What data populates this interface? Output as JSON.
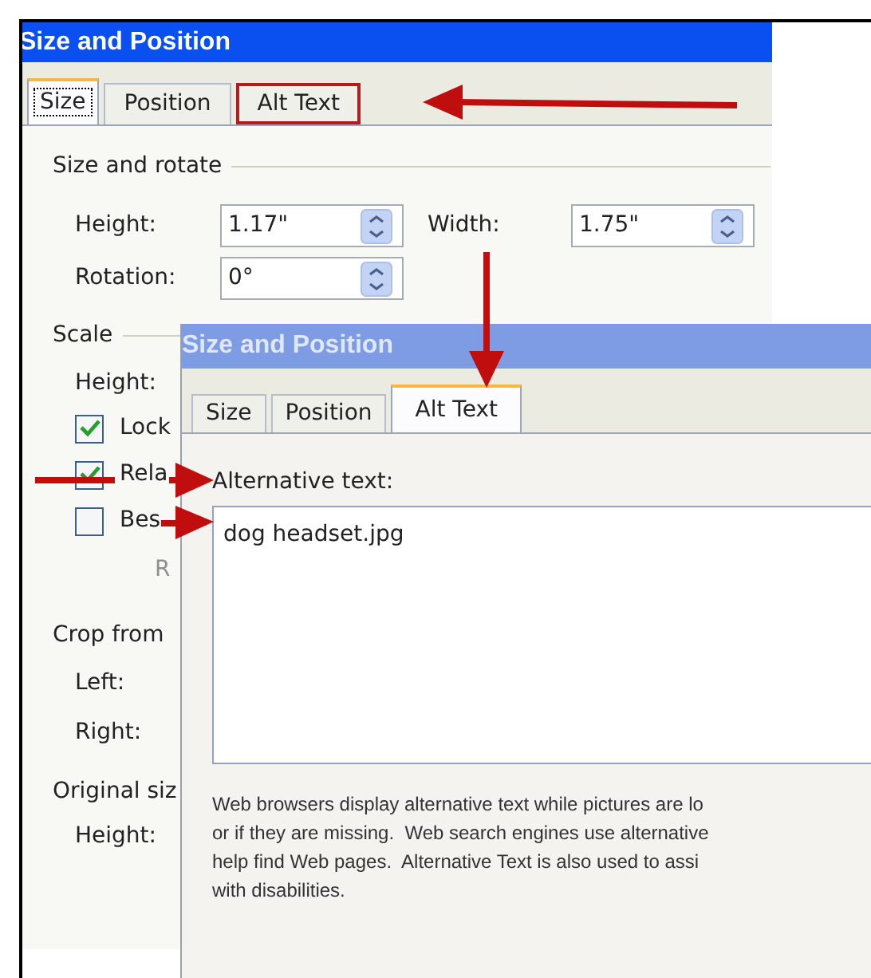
{
  "back_dialog": {
    "title": "Size and Position",
    "tabs": [
      {
        "label": "Size",
        "selected": true,
        "highlighted": false
      },
      {
        "label": "Position",
        "selected": false,
        "highlighted": false
      },
      {
        "label": "Alt Text",
        "selected": false,
        "highlighted": true
      }
    ],
    "size_and_rotate": {
      "heading": "Size and rotate",
      "fields": [
        {
          "label": "Height:",
          "value": "1.17\""
        },
        {
          "label": "Width:",
          "value": "1.75\""
        },
        {
          "label": "Rotation:",
          "value": "0°"
        }
      ]
    },
    "scale": {
      "heading": "Scale",
      "height_label": "Height:",
      "checkboxes": [
        {
          "label": "Lock",
          "checked": true
        },
        {
          "label": "Rela",
          "checked": true
        },
        {
          "label": "Bes",
          "checked": false
        }
      ],
      "button_fragment": "R"
    },
    "crop_from": {
      "heading": "Crop from",
      "labels": [
        "Left:",
        "Right:"
      ]
    },
    "original_size": {
      "heading": "Original siz",
      "labels": [
        "Height:"
      ]
    }
  },
  "front_dialog": {
    "title": "Size and Position",
    "tabs": [
      {
        "label": "Size",
        "selected": false
      },
      {
        "label": "Position",
        "selected": false
      },
      {
        "label": "Alt Text",
        "selected": true
      }
    ],
    "alt_text_label": "Alternative text:",
    "alt_text_value": "dog headset.jpg",
    "description_lines": [
      "Web browsers display alternative text while pictures are lo",
      "or if they are missing.  Web search engines use alternative",
      "help find Web pages.  Alternative Text is also used to assi",
      "with disabilities."
    ]
  }
}
